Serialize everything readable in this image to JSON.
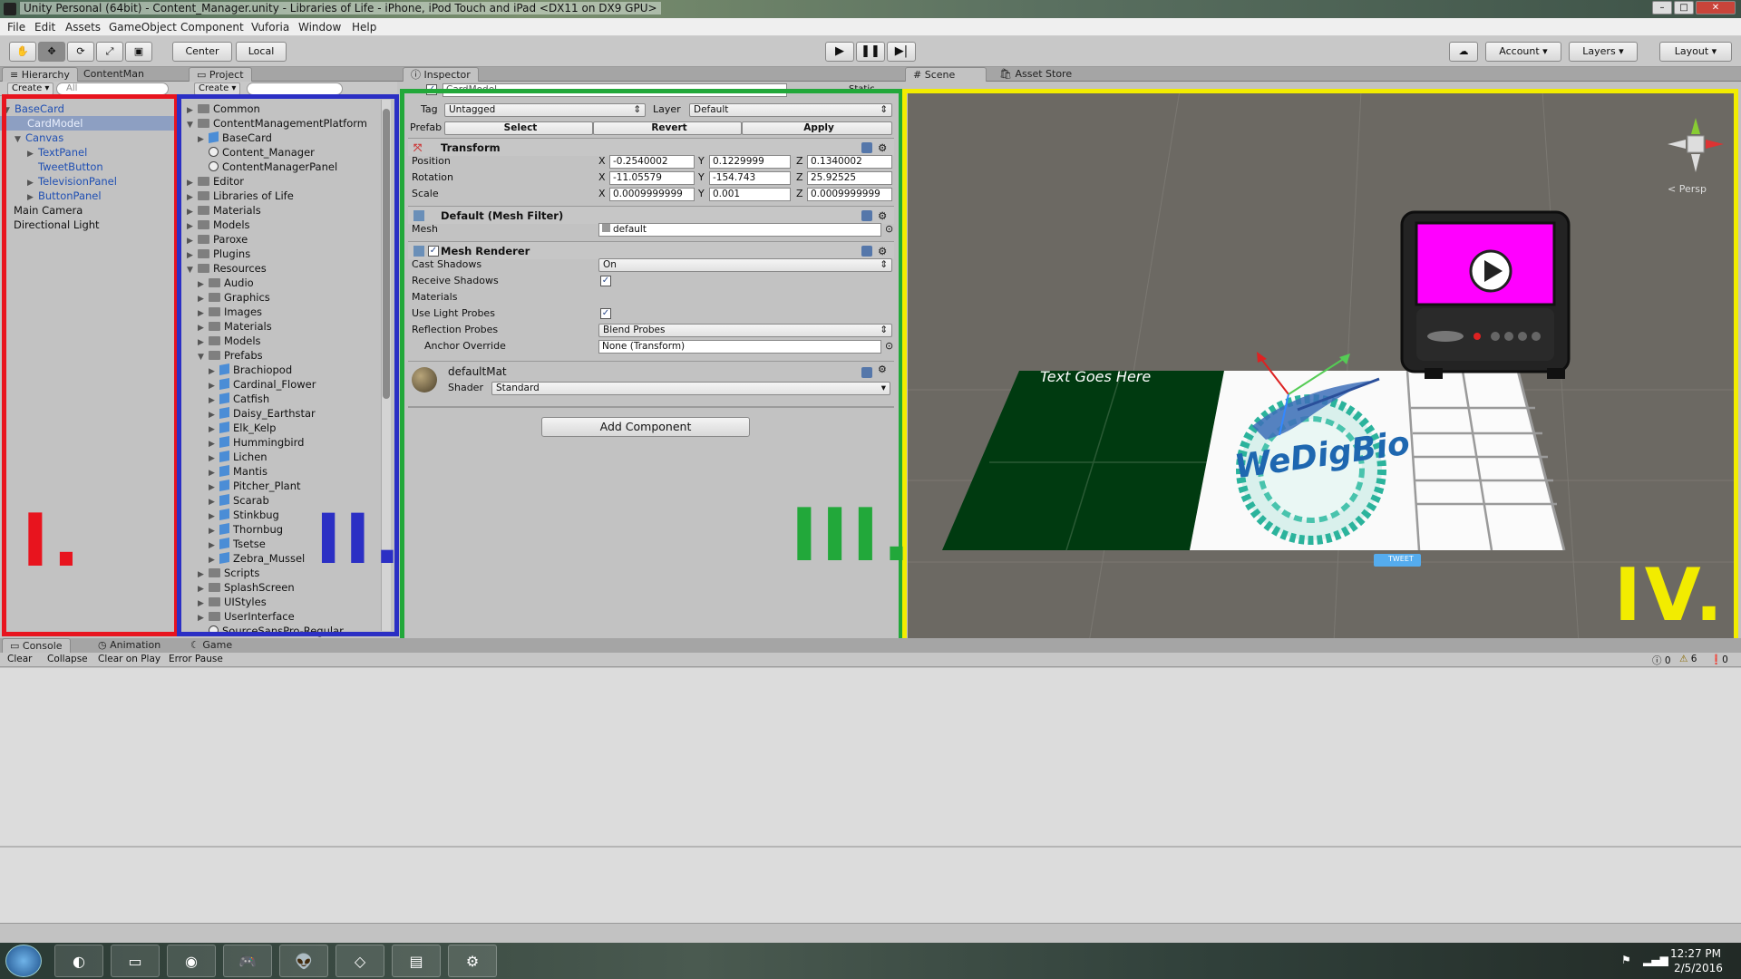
{
  "window": {
    "title": "Unity Personal (64bit) - Content_Manager.unity - Libraries of Life - iPhone, iPod Touch and iPad <DX11 on DX9 GPU>"
  },
  "menu": [
    "File",
    "Edit",
    "Assets",
    "GameObject",
    "Component",
    "Vuforia",
    "Window",
    "Help"
  ],
  "toolbar": {
    "pivot_label": "Center",
    "space_label": "Local",
    "account_label": "Account",
    "layers_label": "Layers",
    "layout_label": "Layout"
  },
  "hierarchy": {
    "tabs": [
      "Hierarchy",
      "ContentMan"
    ],
    "create_label": "Create",
    "search_placeholder": "All",
    "items": [
      {
        "label": "BaseCard"
      },
      {
        "label": "CardModel"
      },
      {
        "label": "Canvas"
      },
      {
        "label": "TextPanel"
      },
      {
        "label": "TweetButton"
      },
      {
        "label": "TelevisionPanel"
      },
      {
        "label": "ButtonPanel"
      },
      {
        "label": "Main Camera"
      },
      {
        "label": "Directional Light"
      }
    ],
    "overlay_label": "I."
  },
  "project": {
    "tab": "Project",
    "create_label": "Create",
    "items": [
      {
        "label": "Common"
      },
      {
        "label": "ContentManagementPlatform"
      },
      {
        "label": "BaseCard"
      },
      {
        "label": "Content_Manager"
      },
      {
        "label": "ContentManagerPanel"
      },
      {
        "label": "Editor"
      },
      {
        "label": "Libraries of Life"
      },
      {
        "label": "Materials"
      },
      {
        "label": "Models"
      },
      {
        "label": "Paroxe"
      },
      {
        "label": "Plugins"
      },
      {
        "label": "Resources"
      },
      {
        "label": "Audio"
      },
      {
        "label": "Graphics"
      },
      {
        "label": "Images"
      },
      {
        "label": "Materials"
      },
      {
        "label": "Models"
      },
      {
        "label": "Prefabs"
      },
      {
        "label": "Brachiopod"
      },
      {
        "label": "Cardinal_Flower"
      },
      {
        "label": "Catfish"
      },
      {
        "label": "Daisy_Earthstar"
      },
      {
        "label": "Elk_Kelp"
      },
      {
        "label": "Hummingbird"
      },
      {
        "label": "Lichen"
      },
      {
        "label": "Mantis"
      },
      {
        "label": "Pitcher_Plant"
      },
      {
        "label": "Scarab"
      },
      {
        "label": "Stinkbug"
      },
      {
        "label": "Thornbug"
      },
      {
        "label": "Tsetse"
      },
      {
        "label": "Zebra_Mussel"
      },
      {
        "label": "Scripts"
      },
      {
        "label": "SplashScreen"
      },
      {
        "label": "UIStyles"
      },
      {
        "label": "UserInterface"
      },
      {
        "label": "SourceSansPro-Regular"
      }
    ],
    "overlay_label": "II."
  },
  "inspector": {
    "tab": "Inspector",
    "object_name": "CardModel",
    "static_label": "Static",
    "tag_label": "Tag",
    "tag_value": "Untagged",
    "layer_label": "Layer",
    "layer_value": "Default",
    "prefab_label": "Prefab",
    "prefab_buttons": [
      "Select",
      "Revert",
      "Apply"
    ],
    "transform": {
      "title": "Transform",
      "position_label": "Position",
      "rotation_label": "Rotation",
      "scale_label": "Scale",
      "x_label": "X",
      "y_label": "Y",
      "z_label": "Z",
      "position": [
        "-0.2540002",
        "0.1229999",
        "0.1340002"
      ],
      "rotation": [
        "-11.05579",
        "-154.743",
        "25.92525"
      ],
      "scale": [
        "0.0009999999",
        "0.001",
        "0.0009999999"
      ]
    },
    "mesh_filter": {
      "title": "Default (Mesh Filter)",
      "mesh_label": "Mesh",
      "mesh_value": "default"
    },
    "mesh_renderer": {
      "title": "Mesh Renderer",
      "cast_shadows_label": "Cast Shadows",
      "cast_shadows_value": "On",
      "receive_shadows_label": "Receive Shadows",
      "materials_label": "Materials",
      "light_probes_label": "Use Light Probes",
      "reflection_label": "Reflection Probes",
      "reflection_value": "Blend Probes",
      "anchor_label": "Anchor Override",
      "anchor_value": "None (Transform)"
    },
    "material": {
      "name": "defaultMat",
      "shader_label": "Shader",
      "shader_value": "Standard"
    },
    "add_component_label": "Add Component",
    "overlay_label": "III."
  },
  "scene": {
    "tabs": [
      "Scene",
      "Asset Store"
    ],
    "persp_label": "< Persp",
    "card_text": "Text Goes Here",
    "logo_text": "WeDigBio",
    "tweet_label": "TWEET",
    "overlay_label": "IV."
  },
  "console": {
    "tabs": [
      "Console",
      "Animation",
      "Game"
    ],
    "buttons": [
      "Clear",
      "Collapse",
      "Clear on Play",
      "Error Pause"
    ],
    "counts": {
      "info": "0",
      "warning": "6",
      "error": "0"
    }
  },
  "taskbar": {
    "time": "12:27 PM",
    "date": "2/5/2016"
  },
  "colors": {
    "hierarchy_outline": "#e8141e",
    "project_outline": "#2b2fc4",
    "inspector_outline": "#22a83a",
    "scene_outline": "#f2ec00",
    "selection": "#3d6fd1",
    "tv_screen": "#ff00ff",
    "card_green": "#003a10"
  },
  "icons": [
    "hand-tool-icon",
    "move-tool-icon",
    "rotate-tool-icon",
    "scale-tool-icon",
    "rect-tool-icon",
    "play-icon",
    "pause-icon",
    "step-icon",
    "cloud-icon",
    "scene-gizmo-icon",
    "play-video-icon",
    "twitter-icon"
  ]
}
